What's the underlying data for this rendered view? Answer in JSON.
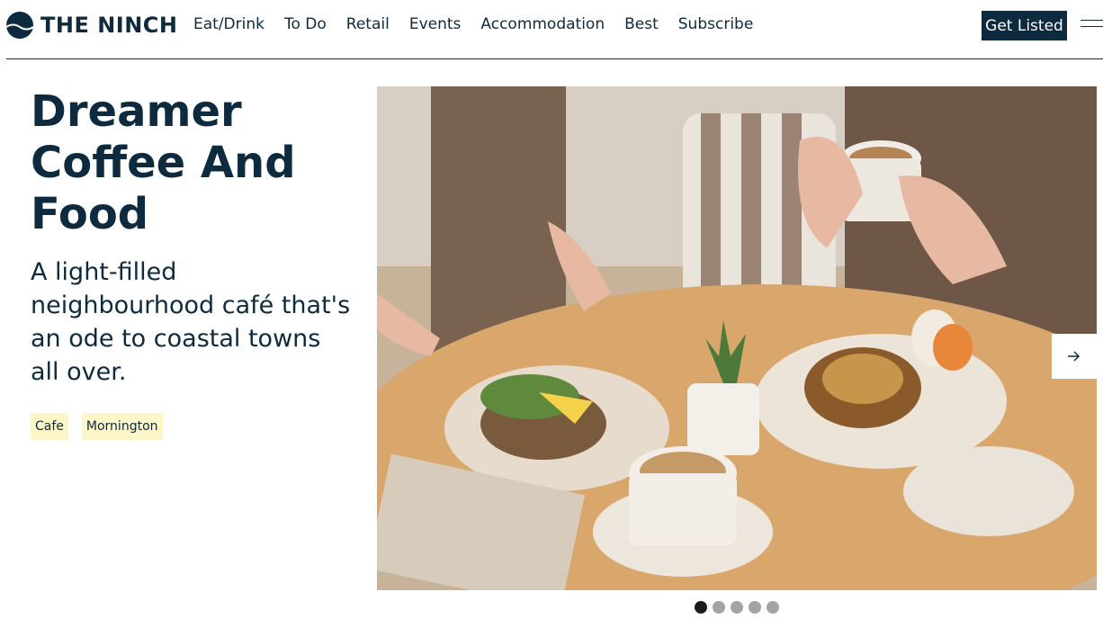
{
  "brand": {
    "name": "THE NINCH",
    "logo_icon": "wave-circle-icon",
    "primary_color": "#0e2a3e"
  },
  "nav": {
    "items": [
      {
        "label": "Eat/Drink"
      },
      {
        "label": "To Do"
      },
      {
        "label": "Retail"
      },
      {
        "label": "Events"
      },
      {
        "label": "Accommodation"
      },
      {
        "label": "Best"
      },
      {
        "label": "Subscribe"
      }
    ]
  },
  "header": {
    "cta_label": "Get Listed",
    "menu_icon": "hamburger-menu-icon"
  },
  "article": {
    "title": "Dreamer Coffee And Food",
    "subtitle": "A light-filled neighbourhood café that's an ode to coastal towns all over.",
    "tags": [
      {
        "label": "Cafe"
      },
      {
        "label": "Mornington"
      }
    ],
    "tag_color": "#fdf6c8"
  },
  "carousel": {
    "next_icon": "arrow-right-icon",
    "slide_count": 5,
    "active_index": 0
  }
}
